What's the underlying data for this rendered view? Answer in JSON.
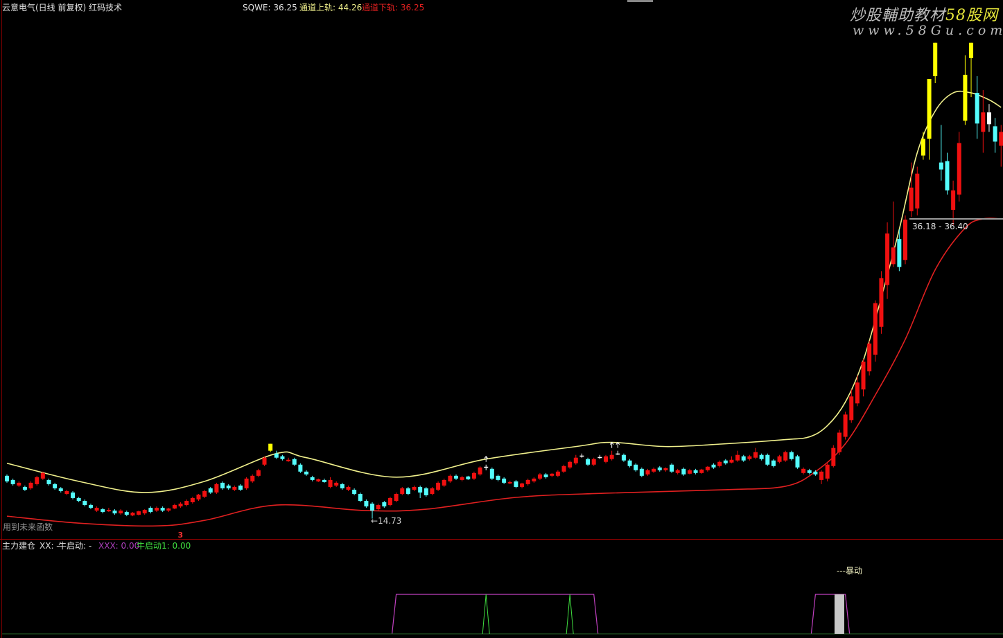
{
  "header": {
    "title": "云意电气(日线 前复权) 红码技术",
    "sqwe": "SQWE: 36.25",
    "upper": "通道上轨: 44.26",
    "lower": "通道下轨: 36.25"
  },
  "watermark": {
    "line1a": "炒股輔助教材",
    "line1b": "58股网",
    "line2": "www.58Gu.com"
  },
  "main_panel": {
    "future_function_note": "用到未来函数",
    "low_label": "←14.73",
    "range_label": "36.18 - 36.40",
    "signal_mark": "3"
  },
  "sub_panel": {
    "name": "主力建仓",
    "xx": "XX: -",
    "niu": "牛启动: -",
    "xxx": "XXX: 0.00",
    "niu1": "牛启动1: 0.00",
    "baodong": "---暴动"
  },
  "colors": {
    "up": "#f01010",
    "down": "#54fcfc",
    "yellow": "#ffff00",
    "white": "#ffffff",
    "upper_rail": "#f0f08c",
    "lower_rail": "#e02020",
    "magenta": "#c040c0",
    "green": "#40e040"
  },
  "chart_data": {
    "type": "candlestick",
    "title": "云意电气(日线 前复权) 红码技术",
    "ylim": [
      13.4,
      49.0
    ],
    "candle_fields": [
      "open",
      "close",
      "high",
      "low",
      "flag"
    ],
    "candles": [
      [
        17.8,
        17.4,
        17.9,
        17.3
      ],
      [
        17.5,
        17.2,
        17.6,
        17.1
      ],
      [
        17.1,
        17.3,
        17.4,
        17.0
      ],
      [
        17.0,
        16.8,
        17.1,
        16.7
      ],
      [
        16.9,
        17.3,
        17.4,
        16.8
      ],
      [
        17.2,
        17.7,
        17.8,
        17.1
      ],
      [
        17.6,
        18.0,
        18.1,
        17.5
      ],
      [
        17.5,
        17.2,
        17.6,
        17.1
      ],
      [
        17.2,
        16.9,
        17.3,
        16.8
      ],
      [
        16.9,
        16.7,
        17.0,
        16.6
      ],
      [
        16.5,
        16.7,
        16.8,
        16.4
      ],
      [
        16.6,
        16.2,
        16.7,
        16.1
      ],
      [
        16.2,
        16.0,
        16.3,
        15.9
      ],
      [
        16.0,
        15.7,
        16.1,
        15.6
      ],
      [
        15.7,
        15.5,
        15.8,
        15.4
      ],
      [
        15.3,
        15.5,
        15.6,
        15.2
      ],
      [
        15.4,
        15.2,
        15.5,
        15.1
      ],
      [
        15.25,
        15.35,
        15.5,
        15.2
      ],
      [
        15.3,
        15.1,
        15.4,
        15.0
      ],
      [
        15.1,
        15.3,
        15.4,
        15.0
      ],
      [
        15.2,
        15.0,
        15.3,
        14.9
      ],
      [
        14.95,
        15.15,
        15.2,
        14.9
      ],
      [
        15.0,
        15.25,
        15.3,
        14.95
      ],
      [
        15.1,
        15.35,
        15.4,
        15.0
      ],
      [
        15.5,
        15.2,
        15.6,
        15.1
      ],
      [
        15.3,
        15.5,
        15.6,
        15.2
      ],
      [
        15.5,
        15.3,
        15.6,
        15.2
      ],
      [
        15.3,
        15.45,
        15.5,
        15.2
      ],
      [
        15.45,
        15.7,
        15.8,
        15.4
      ],
      [
        15.6,
        15.8,
        15.9,
        15.5
      ],
      [
        15.7,
        16.0,
        16.1,
        15.6
      ],
      [
        15.9,
        16.2,
        16.3,
        15.8
      ],
      [
        16.1,
        16.45,
        16.5,
        16.0
      ],
      [
        16.3,
        16.7,
        16.8,
        16.2
      ],
      [
        16.9,
        16.6,
        17.0,
        16.5
      ],
      [
        16.6,
        17.2,
        17.3,
        16.5
      ],
      [
        17.3,
        16.9,
        17.4,
        16.8
      ],
      [
        17.1,
        16.9,
        17.2,
        16.8
      ],
      [
        16.8,
        17.0,
        17.1,
        16.7
      ],
      [
        17.1,
        16.8,
        17.2,
        16.7
      ],
      [
        16.9,
        17.6,
        17.7,
        16.8
      ],
      [
        17.4,
        17.8,
        17.9,
        17.3
      ],
      [
        17.8,
        18.2,
        18.3,
        17.7
      ],
      [
        18.6,
        19.1,
        19.2,
        18.5
      ],
      [
        19.6,
        20.1,
        20.1,
        19.5,
        "Y"
      ],
      [
        19.4,
        19.1,
        19.6,
        19.0
      ],
      [
        19.2,
        19.0,
        19.3,
        18.9
      ],
      [
        18.85,
        18.95,
        19.1,
        18.8
      ],
      [
        19.0,
        18.6,
        19.1,
        18.5
      ],
      [
        18.6,
        18.1,
        18.7,
        18.0
      ],
      [
        18.1,
        17.9,
        18.2,
        17.8
      ],
      [
        17.7,
        17.5,
        17.8,
        17.4
      ],
      [
        17.4,
        17.55,
        17.6,
        17.35
      ],
      [
        17.5,
        17.35,
        17.6,
        17.3
      ],
      [
        17.0,
        17.5,
        17.7,
        16.9
      ],
      [
        17.1,
        17.3,
        17.4,
        17.0
      ],
      [
        17.2,
        16.9,
        17.3,
        16.8
      ],
      [
        16.8,
        17.0,
        17.1,
        16.7
      ],
      [
        16.8,
        16.5,
        16.9,
        16.4
      ],
      [
        16.5,
        16.0,
        16.6,
        15.9
      ],
      [
        16.0,
        15.6,
        16.1,
        15.5
      ],
      [
        15.8,
        15.3,
        15.9,
        14.73
      ],
      [
        15.4,
        15.7,
        15.8,
        15.3
      ],
      [
        15.9,
        15.6,
        16.0,
        15.5
      ],
      [
        15.7,
        16.2,
        16.3,
        15.6
      ],
      [
        16.0,
        16.5,
        16.6,
        15.9
      ],
      [
        16.5,
        16.9,
        17.0,
        16.4
      ],
      [
        16.9,
        16.5,
        17.0,
        16.4
      ],
      [
        16.8,
        17.0,
        17.1,
        16.7
      ],
      [
        17.0,
        16.6,
        17.1,
        16.2
      ],
      [
        16.9,
        16.4,
        17.0,
        16.3
      ],
      [
        16.5,
        16.9,
        17.0,
        16.4
      ],
      [
        16.8,
        17.3,
        17.4,
        16.7
      ],
      [
        17.1,
        17.5,
        17.6,
        17.0
      ],
      [
        17.4,
        17.8,
        17.9,
        17.3
      ],
      [
        17.8,
        17.6,
        17.9,
        17.5
      ],
      [
        17.5,
        17.7,
        17.8,
        17.4
      ],
      [
        17.75,
        17.55,
        17.8,
        17.5
      ],
      [
        17.6,
        18.0,
        18.1,
        17.5
      ],
      [
        17.9,
        18.4,
        18.5,
        17.8
      ],
      [
        18.4,
        18.45,
        18.6,
        18.2,
        "W"
      ],
      [
        18.3,
        17.6,
        18.4,
        17.5
      ],
      [
        17.8,
        17.5,
        17.9,
        17.4
      ],
      [
        17.6,
        17.3,
        17.7,
        17.2
      ],
      [
        17.25,
        17.35,
        17.45,
        17.2
      ],
      [
        17.4,
        17.0,
        17.5,
        16.9
      ],
      [
        17.0,
        17.25,
        17.3,
        16.9
      ],
      [
        17.2,
        17.5,
        17.6,
        17.1
      ],
      [
        17.4,
        17.6,
        17.7,
        17.3
      ],
      [
        17.6,
        17.9,
        18.0,
        17.5
      ],
      [
        17.9,
        17.7,
        18.0,
        17.6
      ],
      [
        17.8,
        17.95,
        18.0,
        17.7
      ],
      [
        17.8,
        18.1,
        18.2,
        17.7
      ],
      [
        18.1,
        18.5,
        18.6,
        18.0
      ],
      [
        18.4,
        18.8,
        18.9,
        18.3
      ],
      [
        18.7,
        19.1,
        19.3,
        18.6
      ],
      [
        19.2,
        19.25,
        19.4,
        19.1,
        "W"
      ],
      [
        19.0,
        18.6,
        19.1,
        18.5
      ],
      [
        18.6,
        19.0,
        19.1,
        18.5
      ],
      [
        19.1,
        19.15,
        19.3,
        19.0,
        "W"
      ],
      [
        18.8,
        19.2,
        19.3,
        18.7
      ],
      [
        19.0,
        19.3,
        19.6,
        18.9
      ],
      [
        19.35,
        19.4,
        19.6,
        19.3,
        "W"
      ],
      [
        19.3,
        18.9,
        19.4,
        18.8
      ],
      [
        18.9,
        18.5,
        19.0,
        18.4
      ],
      [
        18.6,
        18.2,
        18.7,
        18.1
      ],
      [
        18.3,
        17.8,
        18.4,
        17.7
      ],
      [
        17.9,
        18.2,
        18.3,
        17.8
      ],
      [
        18.1,
        18.3,
        18.4,
        18.0
      ],
      [
        18.4,
        18.2,
        18.5,
        18.1
      ],
      [
        18.2,
        18.35,
        18.4,
        18.1
      ],
      [
        18.6,
        18.1,
        18.7,
        18.0
      ],
      [
        18.0,
        18.2,
        18.3,
        17.9
      ],
      [
        18.3,
        17.9,
        18.4,
        17.8
      ],
      [
        17.95,
        18.2,
        18.3,
        17.9
      ],
      [
        18.2,
        18.0,
        18.3,
        17.9
      ],
      [
        18.0,
        18.25,
        18.3,
        17.95
      ],
      [
        18.2,
        18.45,
        18.5,
        18.1
      ],
      [
        18.6,
        18.4,
        18.7,
        18.3
      ],
      [
        18.5,
        18.8,
        18.9,
        18.4
      ],
      [
        18.9,
        18.7,
        19.0,
        18.6
      ],
      [
        18.75,
        18.95,
        19.2,
        18.7
      ],
      [
        18.9,
        19.3,
        19.6,
        18.8
      ],
      [
        19.2,
        18.9,
        19.3,
        18.8
      ],
      [
        19.0,
        19.2,
        19.3,
        18.9
      ],
      [
        19.1,
        19.5,
        19.8,
        19.0
      ],
      [
        19.3,
        19.0,
        19.4,
        18.9
      ],
      [
        19.3,
        18.6,
        19.4,
        18.5
      ],
      [
        18.9,
        18.5,
        19.0,
        18.4
      ],
      [
        18.8,
        19.2,
        19.3,
        18.7
      ],
      [
        18.9,
        19.5,
        19.6,
        18.8
      ],
      [
        19.5,
        19.0,
        19.6,
        18.9
      ],
      [
        19.2,
        18.4,
        19.3,
        18.3
      ],
      [
        18.0,
        18.3,
        18.4,
        17.9
      ],
      [
        18.2,
        18.0,
        18.3,
        17.9
      ],
      [
        18.1,
        17.9,
        18.2,
        17.8
      ],
      [
        17.5,
        18.1,
        18.2,
        17.2
      ],
      [
        17.6,
        18.6,
        18.7,
        17.4
      ],
      [
        18.5,
        19.8,
        20.0,
        18.4
      ],
      [
        19.5,
        20.9,
        21.1,
        19.3
      ],
      [
        20.6,
        22.2,
        22.4,
        20.4
      ],
      [
        21.8,
        23.5,
        24.0,
        21.6
      ],
      [
        23.0,
        24.5,
        25.0,
        22.8
      ],
      [
        24.0,
        26.0,
        26.2,
        23.5
      ],
      [
        25.3,
        27.3,
        27.5,
        25.0
      ],
      [
        26.5,
        30.2,
        30.4,
        26.0
      ],
      [
        28.5,
        32.0,
        32.5,
        28.0
      ],
      [
        31.5,
        35.2,
        36.0,
        30.5
      ],
      [
        33.0,
        34.2,
        37.5,
        32.8
      ],
      [
        34.8,
        32.8,
        35.5,
        32.5
      ],
      [
        33.3,
        36.2,
        36.5,
        33.0
      ],
      [
        36.8,
        38.5,
        40.3,
        36.4
      ],
      [
        37.0,
        39.5,
        40.0,
        36.5
      ],
      [
        40.8,
        42.0,
        42.5,
        40.5,
        "Y"
      ],
      [
        42.0,
        46.3,
        46.3,
        40.5,
        "Y"
      ],
      [
        46.5,
        48.9,
        48.9,
        46.0,
        "Y"
      ],
      [
        40.3,
        39.8,
        43.0,
        39.0
      ],
      [
        40.4,
        38.3,
        41.0,
        38.0
      ],
      [
        36.9,
        38.3,
        39.0,
        35.8
      ],
      [
        38.0,
        41.7,
        42.5,
        37.5
      ],
      [
        43.3,
        46.6,
        48.0,
        43.0,
        "Y"
      ],
      [
        47.8,
        48.9,
        48.9,
        45.0,
        "Y"
      ],
      [
        45.3,
        43.1,
        46.5,
        42.0
      ],
      [
        42.5,
        43.9,
        45.5,
        41.0
      ],
      [
        43.9,
        43.05,
        44.5,
        42.5,
        "W"
      ],
      [
        42.9,
        41.8,
        43.5,
        41.0
      ],
      [
        41.5,
        42.5,
        43.0,
        40.0
      ]
    ],
    "upper_rail": [
      [
        0,
        18.7
      ],
      [
        12,
        17.4
      ],
      [
        23,
        16.6
      ],
      [
        33,
        17.4
      ],
      [
        45,
        19.4
      ],
      [
        50,
        19.1
      ],
      [
        65,
        17.7
      ],
      [
        80,
        19.0
      ],
      [
        95,
        19.9
      ],
      [
        101,
        20.2
      ],
      [
        110,
        19.9
      ],
      [
        120,
        20.1
      ],
      [
        130,
        20.4
      ],
      [
        134,
        20.6
      ],
      [
        137,
        21.4
      ],
      [
        140,
        23.1
      ],
      [
        143,
        26.1
      ],
      [
        146,
        30.6
      ],
      [
        149,
        35.5
      ],
      [
        152,
        41.0
      ],
      [
        155,
        44.0
      ],
      [
        158,
        45.3
      ],
      [
        161,
        45.3
      ],
      [
        164,
        44.8
      ],
      [
        166,
        44.26
      ]
    ],
    "lower_rail": [
      [
        0,
        14.9
      ],
      [
        12,
        14.4
      ],
      [
        25,
        14.2
      ],
      [
        33,
        14.6
      ],
      [
        45,
        15.7
      ],
      [
        60,
        15.3
      ],
      [
        70,
        15.4
      ],
      [
        85,
        16.25
      ],
      [
        100,
        16.55
      ],
      [
        120,
        16.8
      ],
      [
        130,
        17.05
      ],
      [
        135,
        18.1
      ],
      [
        140,
        20.1
      ],
      [
        145,
        23.6
      ],
      [
        150,
        27.6
      ],
      [
        155,
        32.6
      ],
      [
        160,
        35.6
      ],
      [
        163,
        36.25
      ],
      [
        166,
        36.25
      ]
    ],
    "buy_arrows": [
      80,
      101,
      102
    ],
    "signal_mark_index": 29,
    "low_index": 61,
    "range_level": 36.25,
    "sub": {
      "xxx_on_ranges": [
        [
          65,
          98
        ],
        [
          135,
          140
        ]
      ],
      "niu_spikes": [
        80,
        94
      ],
      "baodong_bars": [
        139
      ]
    }
  }
}
